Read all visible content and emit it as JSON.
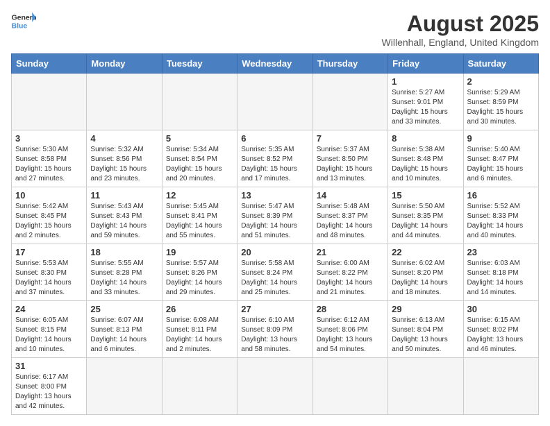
{
  "header": {
    "logo_general": "General",
    "logo_blue": "Blue",
    "month_title": "August 2025",
    "subtitle": "Willenhall, England, United Kingdom"
  },
  "weekdays": [
    "Sunday",
    "Monday",
    "Tuesday",
    "Wednesday",
    "Thursday",
    "Friday",
    "Saturday"
  ],
  "weeks": [
    [
      {
        "day": null,
        "empty": true
      },
      {
        "day": null,
        "empty": true
      },
      {
        "day": null,
        "empty": true
      },
      {
        "day": null,
        "empty": true
      },
      {
        "day": null,
        "empty": true
      },
      {
        "day": "1",
        "sunrise": "5:27 AM",
        "sunset": "9:01 PM",
        "daylight": "15 hours and 33 minutes."
      },
      {
        "day": "2",
        "sunrise": "5:29 AM",
        "sunset": "8:59 PM",
        "daylight": "15 hours and 30 minutes."
      }
    ],
    [
      {
        "day": "3",
        "sunrise": "5:30 AM",
        "sunset": "8:58 PM",
        "daylight": "15 hours and 27 minutes."
      },
      {
        "day": "4",
        "sunrise": "5:32 AM",
        "sunset": "8:56 PM",
        "daylight": "15 hours and 23 minutes."
      },
      {
        "day": "5",
        "sunrise": "5:34 AM",
        "sunset": "8:54 PM",
        "daylight": "15 hours and 20 minutes."
      },
      {
        "day": "6",
        "sunrise": "5:35 AM",
        "sunset": "8:52 PM",
        "daylight": "15 hours and 17 minutes."
      },
      {
        "day": "7",
        "sunrise": "5:37 AM",
        "sunset": "8:50 PM",
        "daylight": "15 hours and 13 minutes."
      },
      {
        "day": "8",
        "sunrise": "5:38 AM",
        "sunset": "8:48 PM",
        "daylight": "15 hours and 10 minutes."
      },
      {
        "day": "9",
        "sunrise": "5:40 AM",
        "sunset": "8:47 PM",
        "daylight": "15 hours and 6 minutes."
      }
    ],
    [
      {
        "day": "10",
        "sunrise": "5:42 AM",
        "sunset": "8:45 PM",
        "daylight": "15 hours and 2 minutes."
      },
      {
        "day": "11",
        "sunrise": "5:43 AM",
        "sunset": "8:43 PM",
        "daylight": "14 hours and 59 minutes."
      },
      {
        "day": "12",
        "sunrise": "5:45 AM",
        "sunset": "8:41 PM",
        "daylight": "14 hours and 55 minutes."
      },
      {
        "day": "13",
        "sunrise": "5:47 AM",
        "sunset": "8:39 PM",
        "daylight": "14 hours and 51 minutes."
      },
      {
        "day": "14",
        "sunrise": "5:48 AM",
        "sunset": "8:37 PM",
        "daylight": "14 hours and 48 minutes."
      },
      {
        "day": "15",
        "sunrise": "5:50 AM",
        "sunset": "8:35 PM",
        "daylight": "14 hours and 44 minutes."
      },
      {
        "day": "16",
        "sunrise": "5:52 AM",
        "sunset": "8:33 PM",
        "daylight": "14 hours and 40 minutes."
      }
    ],
    [
      {
        "day": "17",
        "sunrise": "5:53 AM",
        "sunset": "8:30 PM",
        "daylight": "14 hours and 37 minutes."
      },
      {
        "day": "18",
        "sunrise": "5:55 AM",
        "sunset": "8:28 PM",
        "daylight": "14 hours and 33 minutes."
      },
      {
        "day": "19",
        "sunrise": "5:57 AM",
        "sunset": "8:26 PM",
        "daylight": "14 hours and 29 minutes."
      },
      {
        "day": "20",
        "sunrise": "5:58 AM",
        "sunset": "8:24 PM",
        "daylight": "14 hours and 25 minutes."
      },
      {
        "day": "21",
        "sunrise": "6:00 AM",
        "sunset": "8:22 PM",
        "daylight": "14 hours and 21 minutes."
      },
      {
        "day": "22",
        "sunrise": "6:02 AM",
        "sunset": "8:20 PM",
        "daylight": "14 hours and 18 minutes."
      },
      {
        "day": "23",
        "sunrise": "6:03 AM",
        "sunset": "8:18 PM",
        "daylight": "14 hours and 14 minutes."
      }
    ],
    [
      {
        "day": "24",
        "sunrise": "6:05 AM",
        "sunset": "8:15 PM",
        "daylight": "14 hours and 10 minutes."
      },
      {
        "day": "25",
        "sunrise": "6:07 AM",
        "sunset": "8:13 PM",
        "daylight": "14 hours and 6 minutes."
      },
      {
        "day": "26",
        "sunrise": "6:08 AM",
        "sunset": "8:11 PM",
        "daylight": "14 hours and 2 minutes."
      },
      {
        "day": "27",
        "sunrise": "6:10 AM",
        "sunset": "8:09 PM",
        "daylight": "13 hours and 58 minutes."
      },
      {
        "day": "28",
        "sunrise": "6:12 AM",
        "sunset": "8:06 PM",
        "daylight": "13 hours and 54 minutes."
      },
      {
        "day": "29",
        "sunrise": "6:13 AM",
        "sunset": "8:04 PM",
        "daylight": "13 hours and 50 minutes."
      },
      {
        "day": "30",
        "sunrise": "6:15 AM",
        "sunset": "8:02 PM",
        "daylight": "13 hours and 46 minutes."
      }
    ],
    [
      {
        "day": "31",
        "sunrise": "6:17 AM",
        "sunset": "8:00 PM",
        "daylight": "13 hours and 42 minutes."
      },
      {
        "day": null,
        "empty": true
      },
      {
        "day": null,
        "empty": true
      },
      {
        "day": null,
        "empty": true
      },
      {
        "day": null,
        "empty": true
      },
      {
        "day": null,
        "empty": true
      },
      {
        "day": null,
        "empty": true
      }
    ]
  ]
}
